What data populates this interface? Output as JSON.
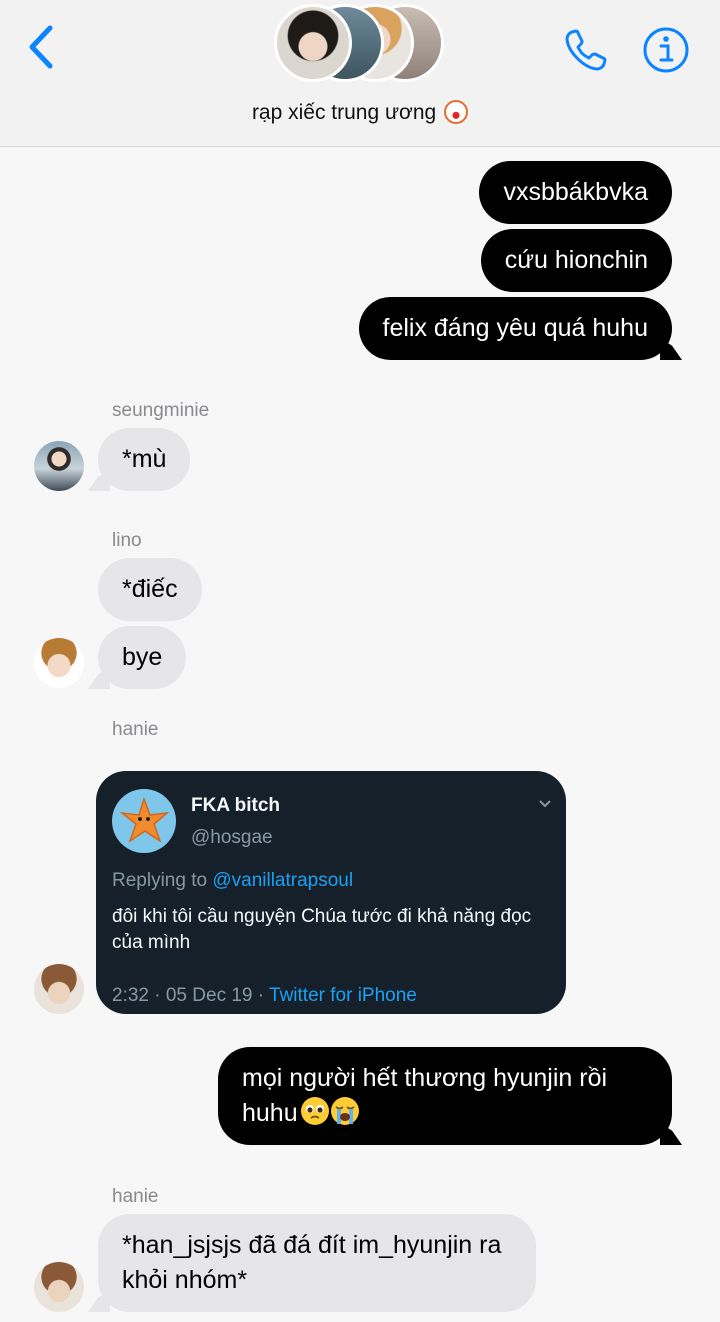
{
  "header": {
    "group_name": "rạp xiếc trung ương",
    "group_emoji": "clown-face-icon",
    "back_icon": "chevron-left-icon",
    "call_icon": "phone-icon",
    "info_icon": "info-icon",
    "accent_color": "#0a84ff"
  },
  "messages": [
    {
      "type": "outgoing",
      "text": "vxsbbákbvka"
    },
    {
      "type": "outgoing",
      "text": "cứu hionchin"
    },
    {
      "type": "outgoing",
      "text": "felix đáng yêu quá huhu"
    },
    {
      "type": "sender",
      "name": "seungminie"
    },
    {
      "type": "incoming",
      "text": "*mù"
    },
    {
      "type": "sender",
      "name": "lino"
    },
    {
      "type": "incoming",
      "text": "*điếc"
    },
    {
      "type": "incoming",
      "text": "bye"
    },
    {
      "type": "sender",
      "name": "hanie"
    },
    {
      "type": "shared-tweet",
      "tweet": {
        "display_name": "FKA bitch",
        "handle": "@hosgae",
        "replying_prefix": "Replying to",
        "replying_to": "@vanillatrapsoul",
        "body": "đôi khi tôi cầu nguyện Chúa tước đi khả năng đọc của mình",
        "time_date": "2:32 · 05 Dec 19 ·",
        "source": "Twitter for iPhone"
      }
    },
    {
      "type": "outgoing",
      "text": "mọi người hết thương hyunjin rồi huhu",
      "emojis": [
        "pleading-face-icon",
        "loudly-crying-face-icon"
      ]
    },
    {
      "type": "sender",
      "name": "hanie"
    },
    {
      "type": "incoming",
      "text": "*han_jsjsjs đã đá đít im_hyunjin ra khỏi nhóm*"
    }
  ],
  "colors": {
    "outgoing_bubble": "#000000",
    "incoming_bubble": "#e6e6e8",
    "tweet_background": "#15202b",
    "tweet_link": "#1da1f2"
  }
}
